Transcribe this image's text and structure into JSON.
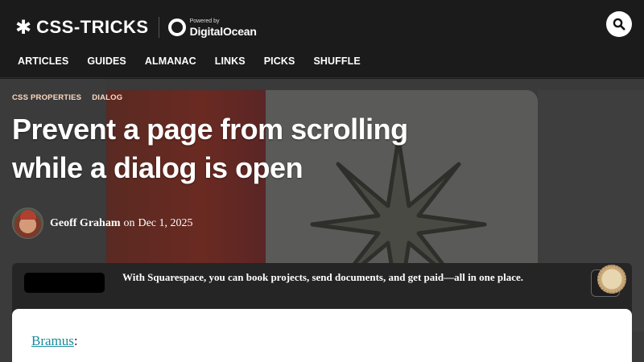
{
  "header": {
    "logo_text": "CSS-TRICKS",
    "logo_star": "✱",
    "sponsor_powered": "Powered by",
    "sponsor_name": "DigitalOcean",
    "search_icon": "search-icon"
  },
  "nav": {
    "items": [
      "ARTICLES",
      "GUIDES",
      "ALMANAC",
      "LINKS",
      "PICKS",
      "SHUFFLE"
    ]
  },
  "article": {
    "tags": [
      "CSS PROPERTIES",
      "DIALOG"
    ],
    "title": "Prevent a page from scrolling while a dialog is open",
    "author": "Geoff Graham",
    "date_prefix": "on",
    "date": "Dec 1, 2025"
  },
  "ad": {
    "text": "With Squarespace, you can book projects, send documents, and get paid—all in one place."
  },
  "content": {
    "link_text": "Bramus",
    "after_link": ":"
  },
  "colors": {
    "background": "#1b1b1b",
    "tag_color": "#ffd8c0",
    "link_color": "#1a8a9c"
  }
}
